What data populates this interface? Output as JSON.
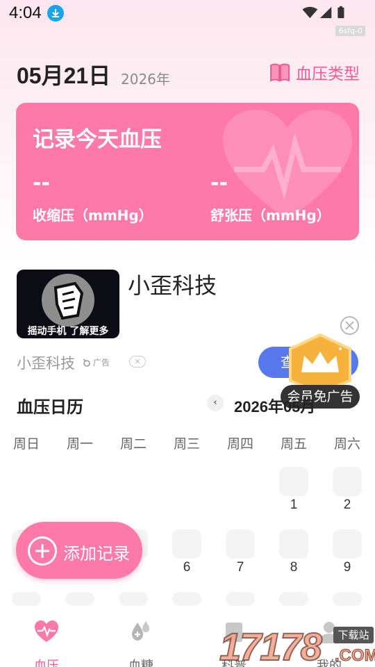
{
  "status_bar": {
    "time": "4:04",
    "tag": "6sfq-0"
  },
  "header": {
    "date": "05月21日",
    "year": "2026年",
    "bp_type_label": "血压类型"
  },
  "record_card": {
    "title": "记录今天血压",
    "systolic_value": "--",
    "systolic_label": "收缩压（mmHg）",
    "diastolic_value": "--",
    "diastolic_label": "舒张压（mmHg）"
  },
  "ad": {
    "name": "小歪科技",
    "thumb_caption": "摇动手机 了解更多",
    "brand": "小歪科技",
    "ad_label": "广告",
    "button_label": "查",
    "vip_badge": "会员免广告"
  },
  "calendar": {
    "title": "血压日历",
    "month": "2026年05月",
    "weekdays": [
      "周日",
      "周一",
      "周二",
      "周三",
      "周四",
      "周五",
      "周六"
    ],
    "days": [
      "1",
      "2",
      "6",
      "7",
      "8",
      "9"
    ]
  },
  "fab": {
    "label": "添加记录"
  },
  "bottom_nav": {
    "items": [
      {
        "label": "血压",
        "active": true
      },
      {
        "label": "血糖",
        "active": false
      },
      {
        "label": "科普",
        "active": false
      },
      {
        "label": "我的",
        "active": false
      }
    ]
  },
  "watermark": {
    "text": "17178",
    "sub": "下载站",
    "suffix": ".COM"
  },
  "colors": {
    "accent": "#fd79a8",
    "accent_text": "#ef5b92",
    "ad_button": "#5a78ee"
  }
}
